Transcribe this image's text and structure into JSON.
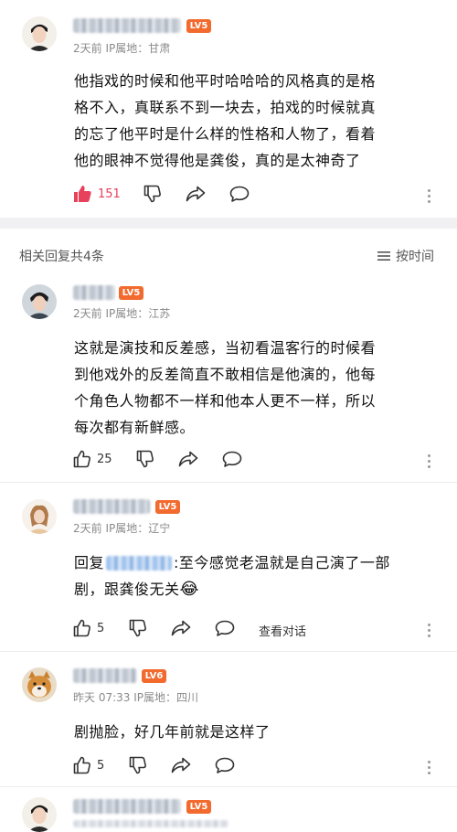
{
  "comments": [
    {
      "level": "LV5",
      "level_color": "#f26a2e",
      "meta": "2天前 IP属地：甘肃",
      "lines": [
        "他指戏的时候和他平时哈哈哈的风格真的是格",
        "格不入，真联系不到一块去，拍戏的时候就真",
        "的忘了他平时是什么样的性格和人物了，看着",
        "他的眼神不觉得他是龚俊，真的是太神奇了"
      ],
      "likes": "151"
    }
  ],
  "replies_header": {
    "title": "相关回复共4条",
    "sort_label": "按时间"
  },
  "replies": [
    {
      "level": "LV5",
      "level_color": "#f26a2e",
      "meta": "2天前 IP属地：江苏",
      "lines": [
        "这就是演技和反差感，当初看温客行的时候看",
        "到他戏外的反差简直不敢相信是他演的，他每",
        "个角色人物都不一样和他本人更不一样，所以",
        "每次都有新鲜感。"
      ],
      "likes": "25"
    },
    {
      "level": "LV5",
      "level_color": "#f26a2e",
      "meta": "2天前 IP属地：辽宁",
      "reply_prefix": "回复",
      "line1_rest": ":至今感觉老温就是自己演了一部",
      "line2": "剧，跟龚俊无关",
      "emoji": "😂",
      "likes": "5",
      "view_dialog": "查看对话"
    },
    {
      "level": "LV6",
      "level_color": "#f26a2e",
      "meta": "昨天 07:33 IP属地：四川",
      "lines": [
        "剧抛脸，好几年前就是这样了"
      ],
      "likes": "5"
    },
    {
      "level": "LV5",
      "level_color": "#f26a2e"
    }
  ]
}
